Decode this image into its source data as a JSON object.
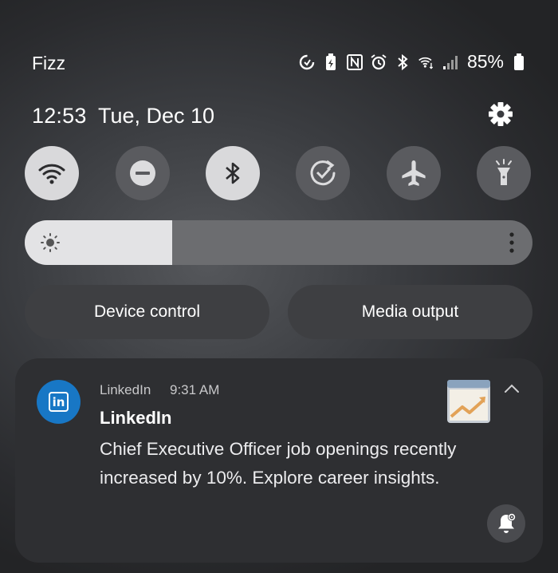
{
  "status_bar": {
    "carrier": "Fizz",
    "battery_percent": "85%",
    "icons": [
      "data-saver-icon",
      "battery-saver-icon",
      "nfc-icon",
      "alarm-icon",
      "bluetooth-icon",
      "wifi-calling-icon",
      "signal-icon",
      "battery-icon"
    ]
  },
  "header": {
    "time": "12:53",
    "date": "Tue, Dec 10"
  },
  "quick_tiles": [
    {
      "name": "wifi",
      "icon": "wifi-icon",
      "active": true
    },
    {
      "name": "do-not-disturb",
      "icon": "minus-circle-icon",
      "active": false
    },
    {
      "name": "bluetooth",
      "icon": "bluetooth-icon",
      "active": true
    },
    {
      "name": "auto-rotate",
      "icon": "rotate-check-icon",
      "active": false
    },
    {
      "name": "airplane-mode",
      "icon": "airplane-icon",
      "active": false
    },
    {
      "name": "flashlight",
      "icon": "flashlight-icon",
      "active": false
    }
  ],
  "brightness": {
    "level": 0.29
  },
  "buttons": {
    "device_control": "Device control",
    "media_output": "Media output"
  },
  "notification": {
    "app_name": "LinkedIn",
    "time": "9:31 AM",
    "title": "LinkedIn",
    "body_line1": "Chief Executive Officer job openings recently",
    "body_line2": "increased by 10%. Explore career insights.",
    "icon_text": "in"
  },
  "colors": {
    "linkedin_blue": "#1877c5",
    "tile_on": "#d9d9db",
    "tile_off": "#5a5b5f"
  }
}
